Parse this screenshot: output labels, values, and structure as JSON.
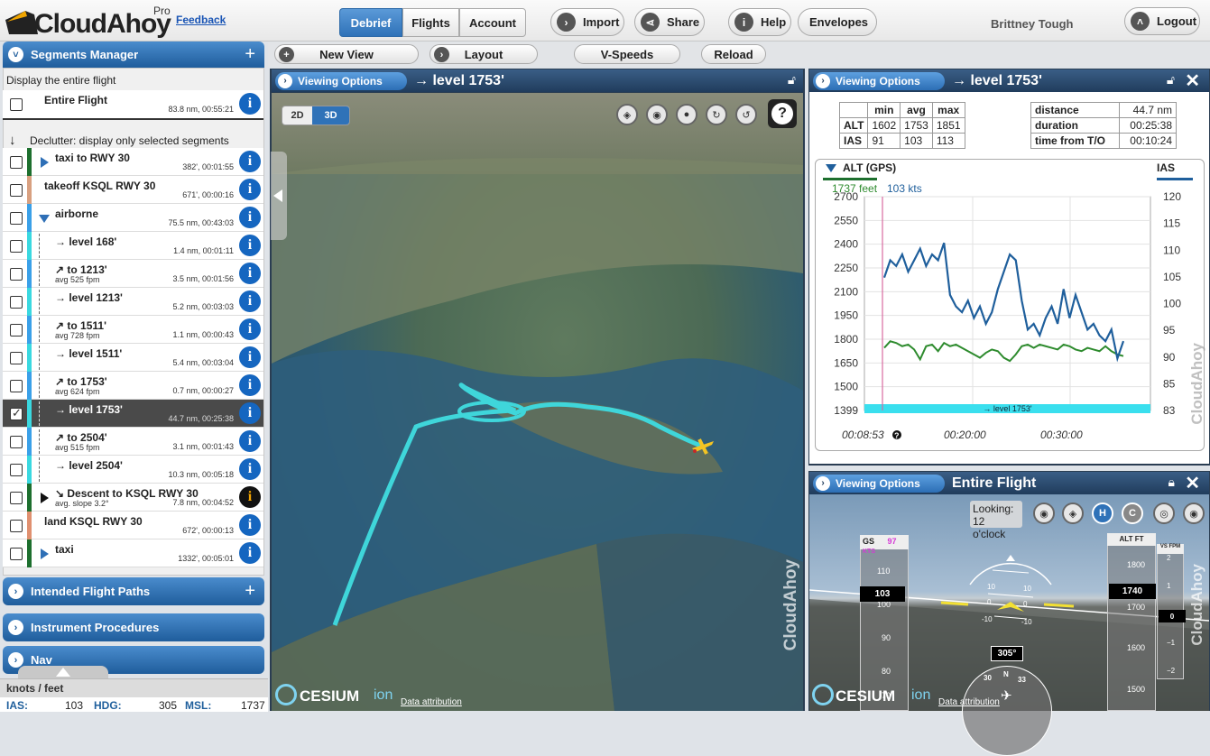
{
  "app": {
    "logo_text": "CloudAhoy",
    "pro_label": "Pro",
    "feedback_label": "Feedback"
  },
  "topnav": {
    "tabs": [
      "Debrief",
      "Flights",
      "Account"
    ],
    "active_tab": "Debrief",
    "buttons": [
      "Import",
      "Share",
      "Help",
      "Envelopes"
    ],
    "user_name": "Brittney Tough",
    "logout_label": "Logout"
  },
  "toolbar2": {
    "new_view": "New View",
    "layout": "Layout",
    "vspeeds": "V-Speeds",
    "reload": "Reload"
  },
  "segments_manager": {
    "title": "Segments Manager",
    "display_entire_label": "Display the entire flight",
    "entire_flight": {
      "name": "Entire Flight",
      "meta": "83.8 nm, 00:55:21"
    },
    "declutter_label": "Declutter: display only selected segments",
    "segments": [
      {
        "name": "taxi to RWY 30",
        "sub": "",
        "meta": "382', 00:01:55",
        "color": "#1d6f2e",
        "indent": 0,
        "marker": "right",
        "checked": false,
        "selected": false
      },
      {
        "name": "takeoff KSQL RWY 30",
        "sub": "",
        "meta": "671', 00:00:16",
        "color": "#d8a080",
        "indent": 0,
        "marker": "none",
        "checked": false,
        "selected": false
      },
      {
        "name": "airborne",
        "sub": "",
        "meta": "75.5 nm, 00:43:03",
        "color": "#3aa0e8",
        "indent": 0,
        "marker": "down",
        "checked": false,
        "selected": false
      },
      {
        "name": "→ level 168'",
        "sub": "",
        "meta": "1.4 nm, 00:01:11",
        "color": "#3ad8e0",
        "indent": 1,
        "marker": "none",
        "checked": false,
        "selected": false
      },
      {
        "name": "↗ to 1213'",
        "sub": "avg 525 fpm",
        "meta": "3.5 nm, 00:01:56",
        "color": "#3aa0e8",
        "indent": 1,
        "marker": "none",
        "checked": false,
        "selected": false
      },
      {
        "name": "→ level 1213'",
        "sub": "",
        "meta": "5.2 nm, 00:03:03",
        "color": "#3ad8e0",
        "indent": 1,
        "marker": "none",
        "checked": false,
        "selected": false
      },
      {
        "name": "↗ to 1511'",
        "sub": "avg 728 fpm",
        "meta": "1.1 nm, 00:00:43",
        "color": "#3aa0e8",
        "indent": 1,
        "marker": "none",
        "checked": false,
        "selected": false
      },
      {
        "name": "→ level 1511'",
        "sub": "",
        "meta": "5.4 nm, 00:03:04",
        "color": "#3ad8e0",
        "indent": 1,
        "marker": "none",
        "checked": false,
        "selected": false
      },
      {
        "name": "↗ to 1753'",
        "sub": "avg 624 fpm",
        "meta": "0.7 nm, 00:00:27",
        "color": "#3aa0e8",
        "indent": 1,
        "marker": "none",
        "checked": false,
        "selected": false
      },
      {
        "name": "→ level 1753'",
        "sub": "",
        "meta": "44.7 nm, 00:25:38",
        "color": "#3ad8e0",
        "indent": 1,
        "marker": "none",
        "checked": true,
        "selected": true
      },
      {
        "name": "↗ to 2504'",
        "sub": "avg 515 fpm",
        "meta": "3.1 nm, 00:01:43",
        "color": "#3aa0e8",
        "indent": 1,
        "marker": "none",
        "checked": false,
        "selected": false
      },
      {
        "name": "→ level 2504'",
        "sub": "",
        "meta": "10.3 nm, 00:05:18",
        "color": "#3ad8e0",
        "indent": 1,
        "marker": "none",
        "checked": false,
        "selected": false
      },
      {
        "name": "↘ Descent to KSQL RWY 30",
        "sub": "avg. slope 3.2°",
        "meta": "7.8 nm, 00:04:52",
        "color": "#1d6f2e",
        "indent": 0,
        "marker": "right-black",
        "checked": false,
        "selected": false,
        "info_dark": true
      },
      {
        "name": "land KSQL RWY 30",
        "sub": "",
        "meta": "672', 00:00:13",
        "color": "#e09070",
        "indent": 0,
        "marker": "none",
        "checked": false,
        "selected": false
      },
      {
        "name": "taxi",
        "sub": "",
        "meta": "1332', 00:05:01",
        "color": "#1d6f2e",
        "indent": 0,
        "marker": "right",
        "checked": false,
        "selected": false
      }
    ]
  },
  "collapsed_panels": [
    "Intended Flight Paths",
    "Instrument Procedures",
    "Nav"
  ],
  "bottom": {
    "units": "knots / feet",
    "ias_label": "IAS:",
    "ias": "103",
    "hdg_label": "HDG:",
    "hdg": "305",
    "msl_label": "MSL:",
    "msl": "1737"
  },
  "view3d": {
    "viewing_options": "Viewing Options",
    "title": "→ level 1753'",
    "mode_2d": "2D",
    "mode_3d": "3D",
    "help": "?",
    "cesium": "CESIUM",
    "ion": "ion",
    "attribution": "Data attribution",
    "watermark": "CloudAhoy"
  },
  "stats_panel": {
    "viewing_options": "Viewing Options",
    "title": "→ level 1753'",
    "table": {
      "headers": [
        "",
        "min",
        "avg",
        "max"
      ],
      "rows": [
        [
          "ALT",
          "1602",
          "1753",
          "1851"
        ],
        [
          "IAS",
          "91",
          "103",
          "113"
        ]
      ]
    },
    "summary": [
      [
        "distance",
        "44.7 nm"
      ],
      [
        "duration",
        "00:25:38"
      ],
      [
        "time from T/O",
        "00:10:24"
      ]
    ]
  },
  "chart_data": {
    "type": "line",
    "title": "",
    "left_series_label": "ALT (GPS)",
    "right_series_label": "IAS",
    "cursor_alt": "1737 feet",
    "cursor_ias": "103 kts",
    "y_left_ticks": [
      "2700",
      "2550",
      "2400",
      "2250",
      "2100",
      "1950",
      "1800",
      "1650",
      "1500",
      "1399"
    ],
    "y_right_ticks": [
      "120",
      "115",
      "110",
      "105",
      "100",
      "95",
      "90",
      "85",
      "83"
    ],
    "x_ticks": [
      "00:08:53",
      "00:20:00",
      "00:30:00"
    ],
    "segment_label": "→ level 1753'",
    "ylim_alt": [
      1399,
      2700
    ],
    "ylim_ias": [
      83,
      120
    ],
    "series": [
      {
        "name": "ALT (GPS)",
        "color": "#2e8b2e",
        "x": [
          0,
          1,
          2,
          3,
          4,
          5,
          6,
          7,
          8,
          9,
          10,
          11,
          12,
          13,
          14,
          15,
          16,
          17,
          18,
          19,
          20,
          21,
          22,
          23,
          24,
          25,
          26,
          27,
          28,
          29,
          30,
          31,
          32,
          33,
          34,
          35,
          36,
          37,
          38,
          39,
          40
        ],
        "values": [
          1780,
          1820,
          1810,
          1790,
          1800,
          1770,
          1710,
          1790,
          1800,
          1760,
          1810,
          1790,
          1800,
          1780,
          1760,
          1740,
          1720,
          1750,
          1770,
          1760,
          1720,
          1700,
          1740,
          1790,
          1800,
          1780,
          1800,
          1790,
          1780,
          1770,
          1800,
          1790,
          1770,
          1760,
          1780,
          1770,
          1760,
          1790,
          1760,
          1740,
          1730
        ]
      },
      {
        "name": "IAS",
        "color": "#1f5f9c",
        "x": [
          0,
          1,
          2,
          3,
          4,
          5,
          6,
          7,
          8,
          9,
          10,
          11,
          12,
          13,
          14,
          15,
          16,
          17,
          18,
          19,
          20,
          21,
          22,
          23,
          24,
          25,
          26,
          27,
          28,
          29,
          30,
          31,
          32,
          33,
          34,
          35,
          36,
          37,
          38,
          39,
          40
        ],
        "values": [
          106,
          109,
          108,
          110,
          107,
          109,
          111,
          108,
          110,
          109,
          112,
          103,
          101,
          100,
          102,
          99,
          101,
          98,
          100,
          104,
          107,
          110,
          109,
          102,
          97,
          98,
          96,
          99,
          101,
          98,
          104,
          99,
          103,
          100,
          97,
          98,
          96,
          95,
          97,
          92,
          95
        ]
      }
    ]
  },
  "pfd": {
    "viewing_options": "Viewing Options",
    "title": "Entire Flight",
    "looking": "Looking:",
    "clock": "12 o'clock",
    "gs_label": "GS",
    "gs_value": "97",
    "gs_unit": "KTS",
    "speed_value": "103",
    "speed_ticks": [
      "110",
      "100",
      "90",
      "80",
      "70"
    ],
    "alt_label": "ALT FT",
    "vs_label": "VS FPM",
    "alt_value": "1740",
    "vs_value": "0",
    "alt_ticks": [
      "1800",
      "1700",
      "1600",
      "1500"
    ],
    "vs_ticks": [
      "2",
      "1",
      "−1",
      "−2"
    ],
    "pitch_ticks": [
      "10",
      "0",
      "-10"
    ],
    "heading": "305°",
    "compass_ticks": [
      "30",
      "N",
      "33"
    ],
    "buttons": [
      "H",
      "C"
    ]
  }
}
